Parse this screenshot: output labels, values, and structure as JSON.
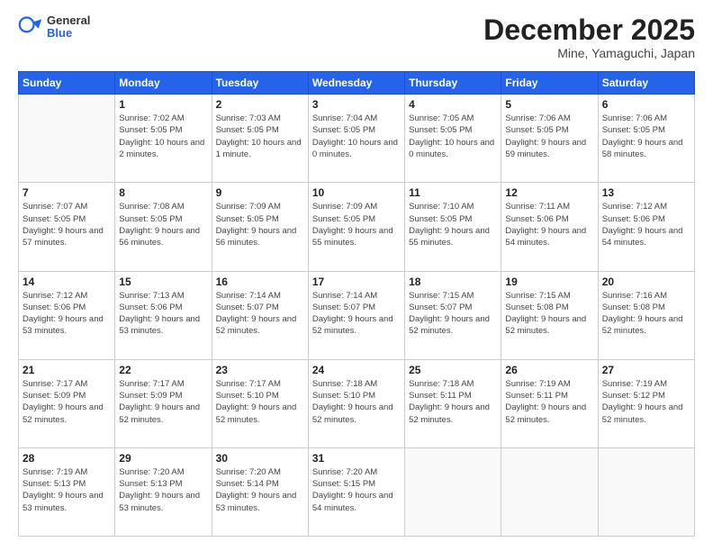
{
  "header": {
    "logo_general": "General",
    "logo_blue": "Blue",
    "month": "December 2025",
    "location": "Mine, Yamaguchi, Japan"
  },
  "days_of_week": [
    "Sunday",
    "Monday",
    "Tuesday",
    "Wednesday",
    "Thursday",
    "Friday",
    "Saturday"
  ],
  "weeks": [
    [
      {
        "day": "",
        "empty": true
      },
      {
        "day": "1",
        "sunrise": "7:02 AM",
        "sunset": "5:05 PM",
        "daylight": "10 hours and 2 minutes."
      },
      {
        "day": "2",
        "sunrise": "7:03 AM",
        "sunset": "5:05 PM",
        "daylight": "10 hours and 1 minute."
      },
      {
        "day": "3",
        "sunrise": "7:04 AM",
        "sunset": "5:05 PM",
        "daylight": "10 hours and 0 minutes."
      },
      {
        "day": "4",
        "sunrise": "7:05 AM",
        "sunset": "5:05 PM",
        "daylight": "10 hours and 0 minutes."
      },
      {
        "day": "5",
        "sunrise": "7:06 AM",
        "sunset": "5:05 PM",
        "daylight": "9 hours and 59 minutes."
      },
      {
        "day": "6",
        "sunrise": "7:06 AM",
        "sunset": "5:05 PM",
        "daylight": "9 hours and 58 minutes."
      }
    ],
    [
      {
        "day": "7",
        "sunrise": "7:07 AM",
        "sunset": "5:05 PM",
        "daylight": "9 hours and 57 minutes."
      },
      {
        "day": "8",
        "sunrise": "7:08 AM",
        "sunset": "5:05 PM",
        "daylight": "9 hours and 56 minutes."
      },
      {
        "day": "9",
        "sunrise": "7:09 AM",
        "sunset": "5:05 PM",
        "daylight": "9 hours and 56 minutes."
      },
      {
        "day": "10",
        "sunrise": "7:09 AM",
        "sunset": "5:05 PM",
        "daylight": "9 hours and 55 minutes."
      },
      {
        "day": "11",
        "sunrise": "7:10 AM",
        "sunset": "5:05 PM",
        "daylight": "9 hours and 55 minutes."
      },
      {
        "day": "12",
        "sunrise": "7:11 AM",
        "sunset": "5:06 PM",
        "daylight": "9 hours and 54 minutes."
      },
      {
        "day": "13",
        "sunrise": "7:12 AM",
        "sunset": "5:06 PM",
        "daylight": "9 hours and 54 minutes."
      }
    ],
    [
      {
        "day": "14",
        "sunrise": "7:12 AM",
        "sunset": "5:06 PM",
        "daylight": "9 hours and 53 minutes."
      },
      {
        "day": "15",
        "sunrise": "7:13 AM",
        "sunset": "5:06 PM",
        "daylight": "9 hours and 53 minutes."
      },
      {
        "day": "16",
        "sunrise": "7:14 AM",
        "sunset": "5:07 PM",
        "daylight": "9 hours and 52 minutes."
      },
      {
        "day": "17",
        "sunrise": "7:14 AM",
        "sunset": "5:07 PM",
        "daylight": "9 hours and 52 minutes."
      },
      {
        "day": "18",
        "sunrise": "7:15 AM",
        "sunset": "5:07 PM",
        "daylight": "9 hours and 52 minutes."
      },
      {
        "day": "19",
        "sunrise": "7:15 AM",
        "sunset": "5:08 PM",
        "daylight": "9 hours and 52 minutes."
      },
      {
        "day": "20",
        "sunrise": "7:16 AM",
        "sunset": "5:08 PM",
        "daylight": "9 hours and 52 minutes."
      }
    ],
    [
      {
        "day": "21",
        "sunrise": "7:17 AM",
        "sunset": "5:09 PM",
        "daylight": "9 hours and 52 minutes."
      },
      {
        "day": "22",
        "sunrise": "7:17 AM",
        "sunset": "5:09 PM",
        "daylight": "9 hours and 52 minutes."
      },
      {
        "day": "23",
        "sunrise": "7:17 AM",
        "sunset": "5:10 PM",
        "daylight": "9 hours and 52 minutes."
      },
      {
        "day": "24",
        "sunrise": "7:18 AM",
        "sunset": "5:10 PM",
        "daylight": "9 hours and 52 minutes."
      },
      {
        "day": "25",
        "sunrise": "7:18 AM",
        "sunset": "5:11 PM",
        "daylight": "9 hours and 52 minutes."
      },
      {
        "day": "26",
        "sunrise": "7:19 AM",
        "sunset": "5:11 PM",
        "daylight": "9 hours and 52 minutes."
      },
      {
        "day": "27",
        "sunrise": "7:19 AM",
        "sunset": "5:12 PM",
        "daylight": "9 hours and 52 minutes."
      }
    ],
    [
      {
        "day": "28",
        "sunrise": "7:19 AM",
        "sunset": "5:13 PM",
        "daylight": "9 hours and 53 minutes."
      },
      {
        "day": "29",
        "sunrise": "7:20 AM",
        "sunset": "5:13 PM",
        "daylight": "9 hours and 53 minutes."
      },
      {
        "day": "30",
        "sunrise": "7:20 AM",
        "sunset": "5:14 PM",
        "daylight": "9 hours and 53 minutes."
      },
      {
        "day": "31",
        "sunrise": "7:20 AM",
        "sunset": "5:15 PM",
        "daylight": "9 hours and 54 minutes."
      },
      {
        "day": "",
        "empty": true
      },
      {
        "day": "",
        "empty": true
      },
      {
        "day": "",
        "empty": true
      }
    ]
  ],
  "labels": {
    "sunrise_prefix": "Sunrise: ",
    "sunset_prefix": "Sunset: ",
    "daylight_prefix": "Daylight: "
  }
}
